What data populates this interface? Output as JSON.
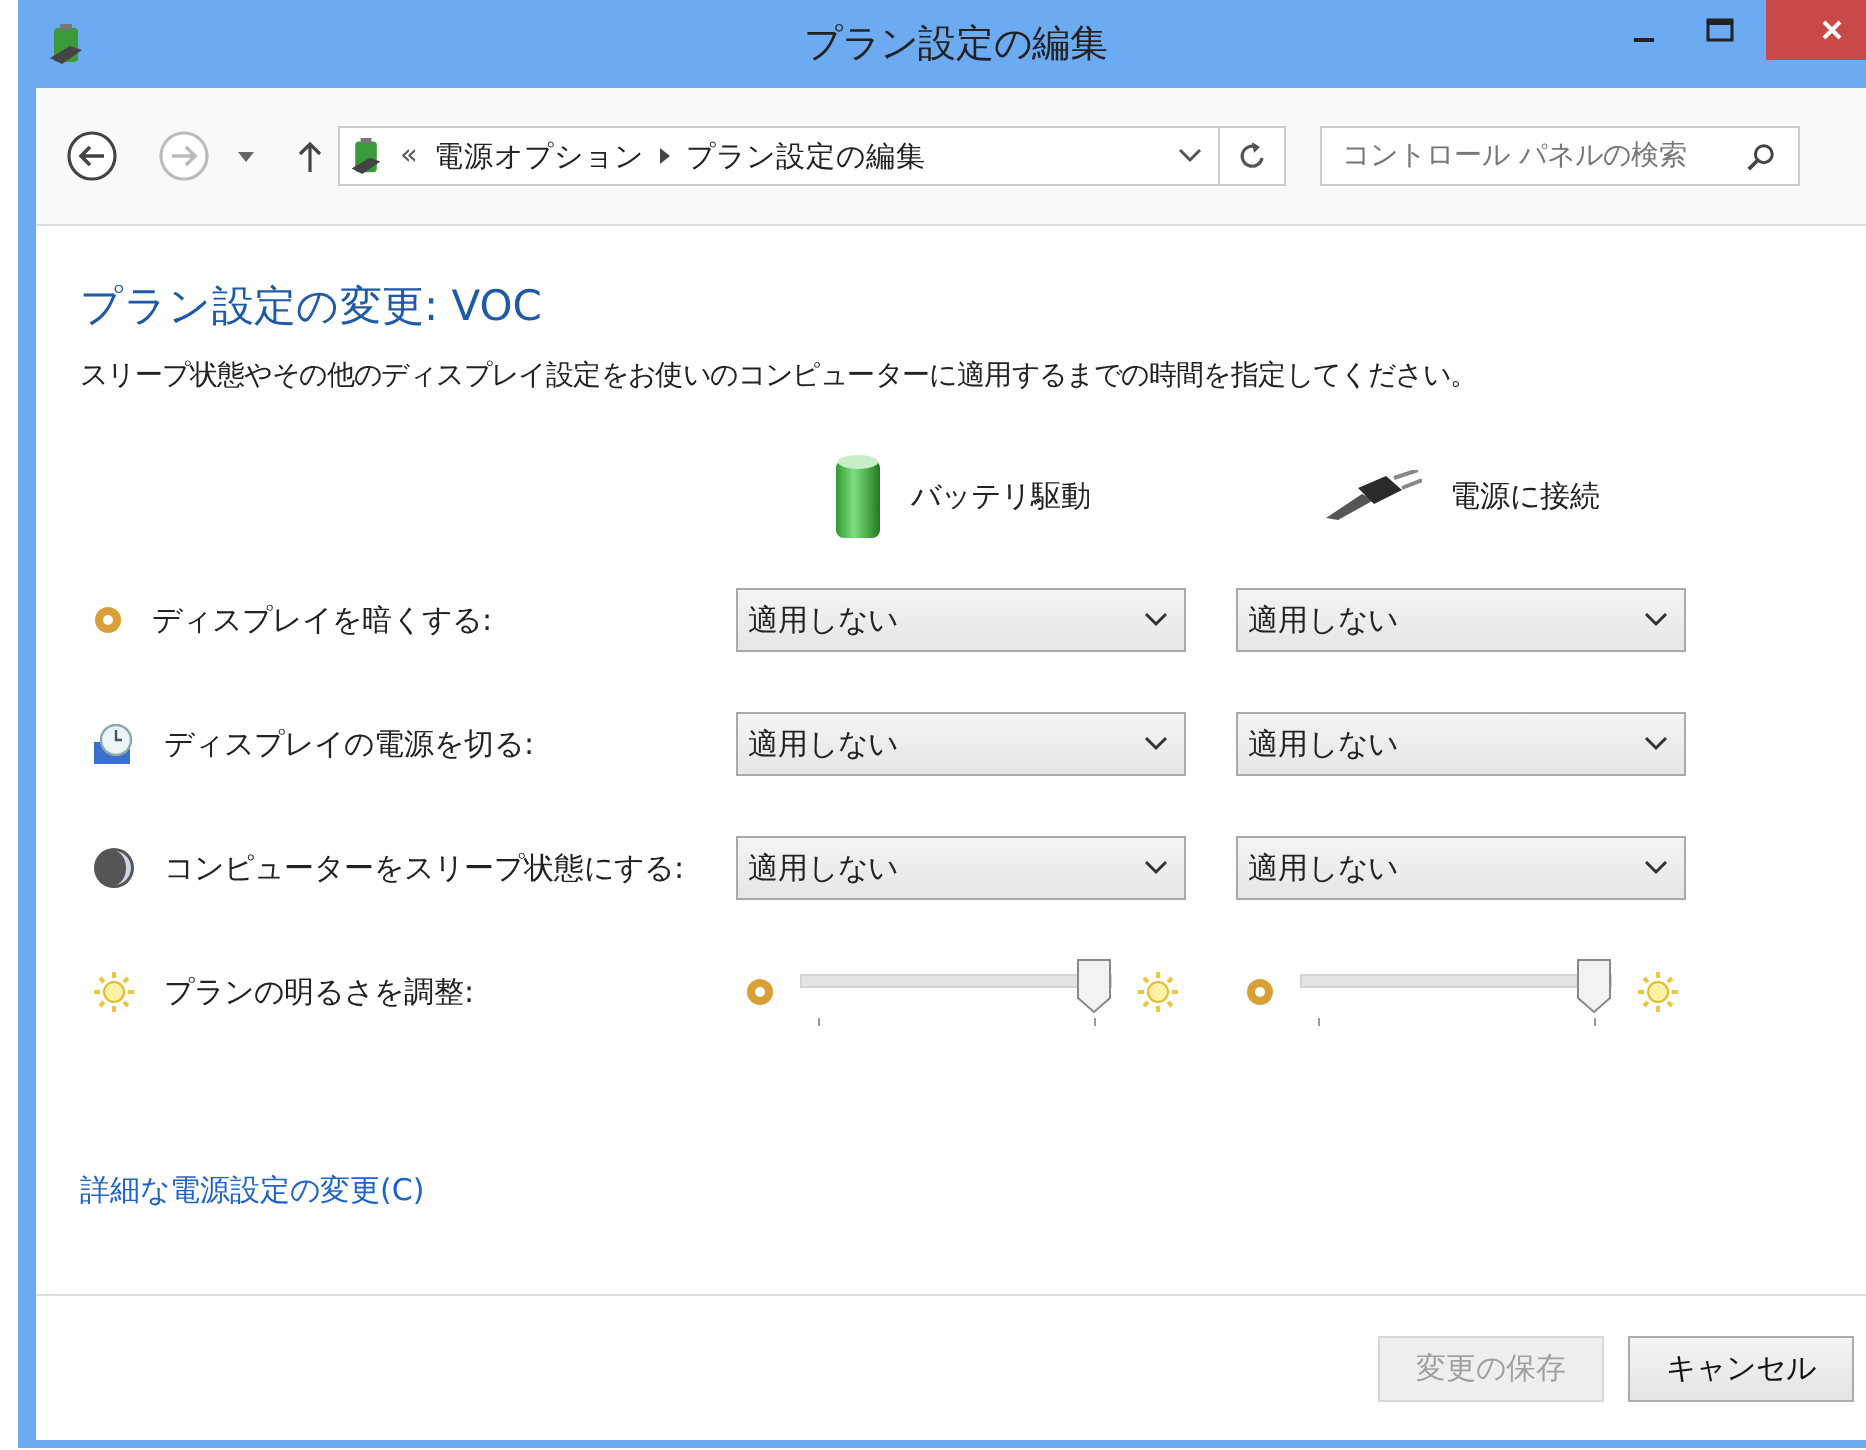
{
  "window": {
    "title": "プラン設定の編集"
  },
  "nav": {
    "back_disabled": false,
    "forward_disabled": true,
    "overflow": "«",
    "breadcrumb": [
      "電源オプション",
      "プラン設定の編集"
    ],
    "search": {
      "placeholder": "コントロール パネルの検索"
    }
  },
  "heading": "プラン設定の変更: VOC",
  "description": "スリープ状態やその他のディスプレイ設定をお使いのコンピューターに適用するまでの時間を指定してください。",
  "columns": [
    {
      "kind": "battery",
      "label": "バッテリ駆動"
    },
    {
      "kind": "plugged",
      "label": "電源に接続"
    }
  ],
  "settings": [
    {
      "kind": "select",
      "label": "ディスプレイを暗くする:",
      "values": [
        "適用しない",
        "適用しない"
      ]
    },
    {
      "kind": "select",
      "label": "ディスプレイの電源を切る:",
      "values": [
        "適用しない",
        "適用しない"
      ]
    },
    {
      "kind": "select",
      "label": "コンピューターをスリープ状態にする:",
      "values": [
        "適用しない",
        "適用しない"
      ]
    },
    {
      "kind": "slider",
      "label": "プランの明るさを調整:",
      "sliders": [
        {
          "level": 1
        },
        {
          "level": 1
        }
      ]
    }
  ],
  "advanced_link": "詳細な電源設定の変更(C)",
  "buttons": [
    {
      "label": "変更の保存",
      "disabled": true
    },
    {
      "label": "キャンセル",
      "disabled": false
    }
  ]
}
